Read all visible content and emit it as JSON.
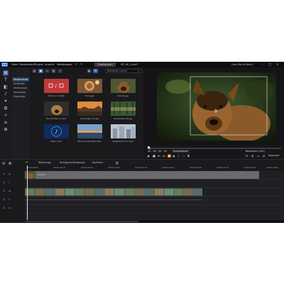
{
  "menu": {
    "items": [
      "Datei",
      "Bearbeiten",
      "Plugins",
      "Ansicht",
      "Wiedergabe"
    ],
    "produce_label": "Produzieren",
    "project_title": "PR_4K_Hund*",
    "user_label": "Uwe Maria Meier"
  },
  "library": {
    "categories": [
      "Medieninhalt",
      "Farbfelder",
      "Hintergrund",
      "Soundclips",
      "Musikklips"
    ],
    "search_placeholder": "Bibliothek suchen",
    "items": [
      {
        "label": "Premium Inhalt"
      },
      {
        "label": "Food.jpg"
      },
      {
        "label": "Hund2.jpg"
      },
      {
        "label": "Hund/Video 1.mp4"
      },
      {
        "label": "Landscape 01.jpg"
      },
      {
        "label": "Landscape 02.jpg"
      },
      {
        "label": "Hallo.mp3"
      },
      {
        "label": "Meer/Landschaft.mp4"
      },
      {
        "label": "Skateboard 01.mp4"
      }
    ]
  },
  "preview": {
    "timecode": "00 ; 00 ; 00 ; 00",
    "mode_label": "Ansichtsmod",
    "right_label": "Bearbeiten (Ctrl)",
    "fit_label": "Anpassen",
    "progress": 0.02
  },
  "timeline": {
    "toolbar": [
      "Werkzeuge",
      "Korrigieren/Verbessern",
      "Keyframe"
    ],
    "ruler": [
      "00;00;00;00",
      "00;00;03;10",
      "00;00;06;20",
      "00;00;10;00",
      "00;00;13;10",
      "00;00;16;20",
      "00;00;20;00",
      "00;00;23;10",
      "00;00;26;20",
      "00;00;30;00"
    ],
    "tracks": [
      {
        "label": "1."
      },
      {
        "label": "1."
      },
      {
        "label": "2."
      },
      {
        "label": "2."
      },
      {
        "label": "3."
      }
    ],
    "clip_label": "Hund1"
  },
  "colors": {
    "accent": "#2f5da8",
    "playhead": "#e0e0e0",
    "selection": "#2a3f66"
  }
}
